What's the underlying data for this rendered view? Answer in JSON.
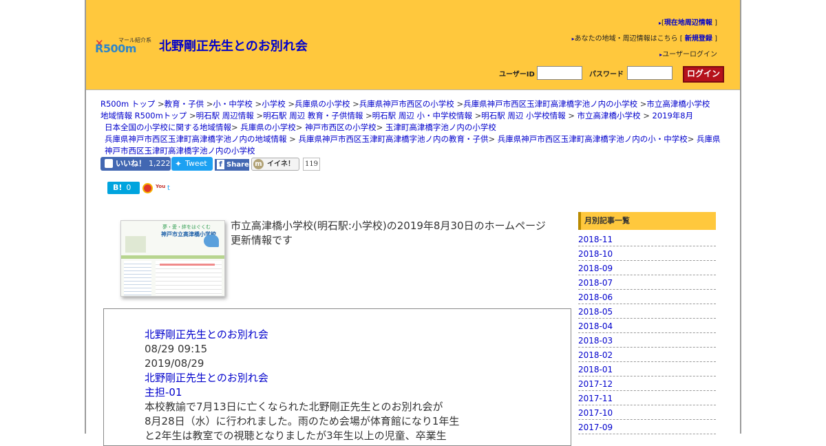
{
  "header": {
    "logo_tagline": "マール紹介系",
    "logo_main": "R500m",
    "site_title": "北野剛正先生とのお別れ会",
    "links": {
      "nearby_prefix": "[",
      "nearby": "現在地周辺情報",
      "nearby_suffix": "]",
      "register_prefix": "あなたの地域・周辺情報はこちら [",
      "register": "新規登録",
      "register_suffix": "]",
      "user_login": "ユーザーログイン"
    },
    "login": {
      "user_id_label": "ユーザーID",
      "password_label": "パスワード",
      "button": "ログイン"
    }
  },
  "breadcrumbs": {
    "line1": [
      "R500m トップ",
      " >",
      "教育・子供",
      " >",
      "小・中学校",
      " >",
      "小学校",
      " >",
      "兵庫県の小学校",
      " >",
      "兵庫県神戸市西区の小学校",
      " >",
      "兵庫県神戸市西区玉津町高津橋字池ノ内の小学校",
      " >",
      "市立高津橋小学校"
    ],
    "line2": [
      "地域情報 R500mトップ",
      " >",
      "明石駅 周辺情報",
      " >",
      "明石駅 周辺 教育・子供情報",
      " >",
      "明石駅 周辺 小・中学校情報",
      " >",
      "明石駅 周辺 小学校情報",
      " > ",
      "市立高津橋小学校",
      " > ",
      "2019年8月"
    ],
    "line3": [
      "日本全国の小学校に関する地域情報",
      "> ",
      "兵庫県の小学校",
      "> ",
      "神戸市西区の小学校",
      "> ",
      "玉津町高津橋字池ノ内の小学校"
    ],
    "line4": [
      "兵庫県神戸市西区玉津町高津橋字池ノ内の地域情報",
      " > ",
      "兵庫県神戸市西区玉津町高津橋字池ノ内の教育・子供",
      "> ",
      "兵庫県神戸市西区玉津町高津橋字池ノ内の小・中学校",
      "> ",
      "兵庫県"
    ],
    "line5": [
      "神戸市西区玉津町高津橋字池ノ内の小学校"
    ]
  },
  "social": {
    "fb_like": "いいね！",
    "fb_like_count": "1,222",
    "tweet": "Tweet",
    "fb_share": "Share",
    "mixi": "イイネ！",
    "mixi_count": "119",
    "hatena": "B!",
    "hatena_count": "0",
    "youtube_mark": "You"
  },
  "thumbnail": {
    "tagline": "夢・愛・絆をはぐくむ",
    "school_name": "神戸市立高津橋小学校"
  },
  "intro_text": "市立高津橋小学校(明石駅:小学校)の2019年8月30日のホームページ更新情報です",
  "article": {
    "title_link": "北野剛正先生とのお別れ会",
    "datetime": "08/29 09:15",
    "date": "2019/08/29",
    "title_link2": "北野剛正先生とのお別れ会",
    "category": "主担-01",
    "body_line1": "本校教諭で7月13日に亡くなられた北野剛正先生とのお別れ会が",
    "body_line2": "8月28日（水）に行われました。雨のため会場が体育館になり1年生",
    "body_line3": "と2年生は教室での視聴となりましたが3年生以上の児童、卒業生"
  },
  "sidebar": {
    "heading": "月別記事一覧",
    "months": [
      "2018-11",
      "2018-10",
      "2018-09",
      "2018-07",
      "2018-06",
      "2018-05",
      "2018-04",
      "2018-03",
      "2018-02",
      "2018-01",
      "2017-12",
      "2017-11",
      "2017-10",
      "2017-09"
    ]
  },
  "colors": {
    "header_bg": "#ffc83d",
    "link": "#0000cc",
    "login_button": "#b5111b"
  }
}
